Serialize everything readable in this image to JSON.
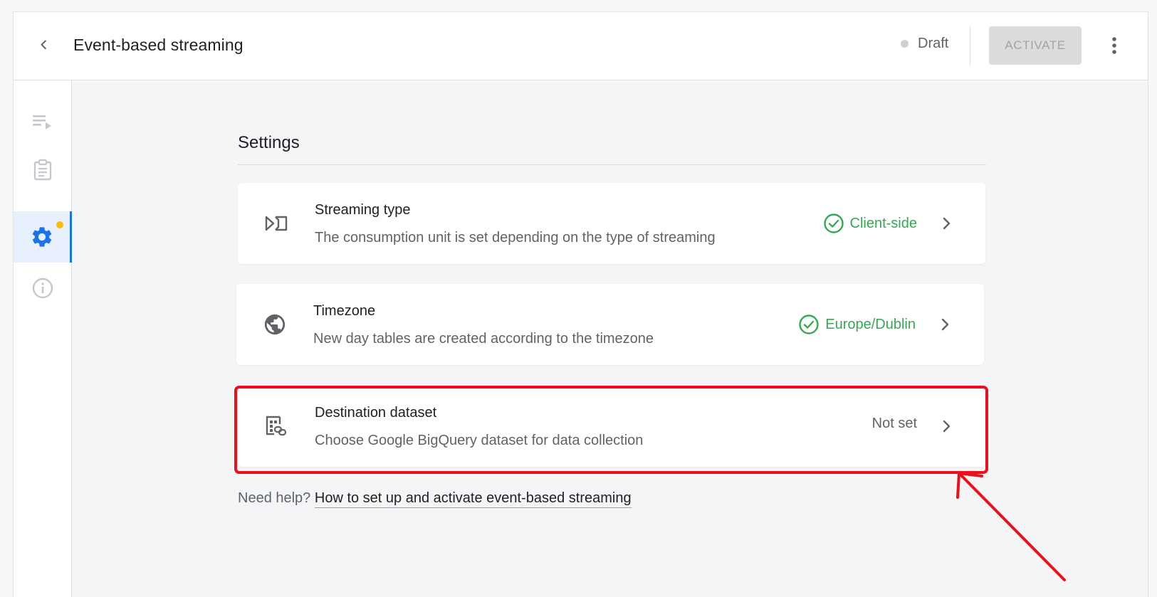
{
  "header": {
    "title": "Event-based streaming",
    "status_label": "Draft",
    "activate_label": "ACTIVATE"
  },
  "sidebar": {
    "items": [
      {
        "name": "playlist-icon",
        "active": false
      },
      {
        "name": "clipboard-icon",
        "active": false
      },
      {
        "name": "gear-icon",
        "active": true,
        "badge": true
      },
      {
        "name": "info-icon",
        "active": false
      }
    ]
  },
  "settings": {
    "section_title": "Settings",
    "cards": [
      {
        "title": "Streaming type",
        "description": "The consumption unit is set depending on the type of streaming",
        "value": "Client-side",
        "status": "ok",
        "icon": "streaming-type-icon"
      },
      {
        "title": "Timezone",
        "description": "New day tables are created according to the timezone",
        "value": "Europe/Dublin",
        "status": "ok",
        "icon": "globe-icon"
      },
      {
        "title": "Destination dataset",
        "description": "Choose Google BigQuery dataset for data collection",
        "value": "Not set",
        "status": "unset",
        "icon": "dataset-link-icon"
      }
    ]
  },
  "help": {
    "prefix": "Need help?",
    "link_text": "How to set up and activate event-based streaming"
  },
  "colors": {
    "accent": "#1a73e8",
    "success": "#34a853",
    "badge": "#fbbc04",
    "annotation": "#ea0f1a"
  }
}
